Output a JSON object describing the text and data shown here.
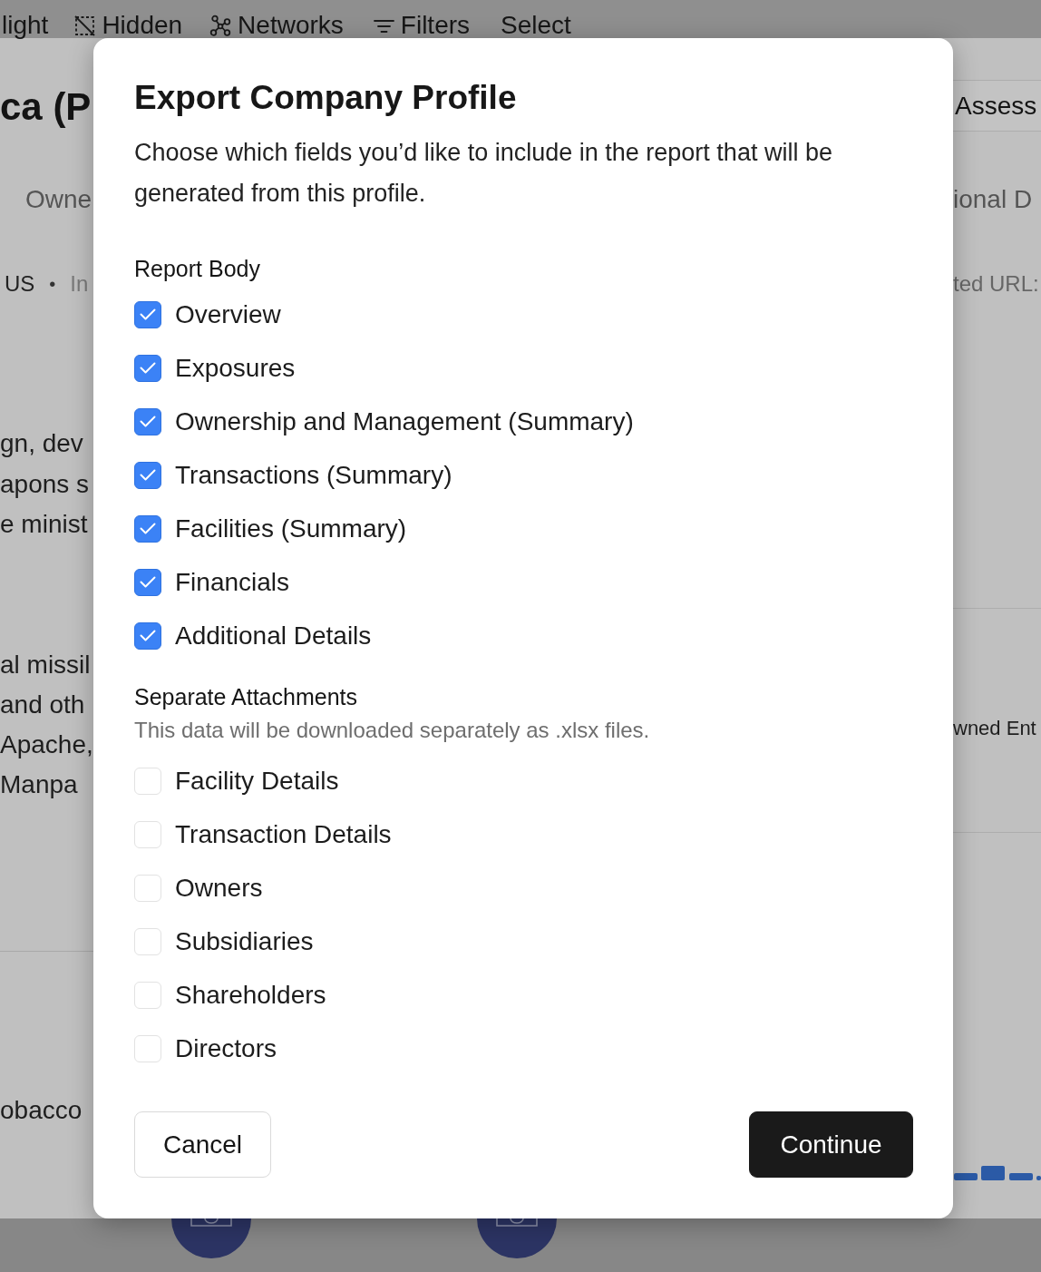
{
  "toolbar": [
    {
      "label": "light",
      "kind": "plain"
    },
    {
      "label": "Hidden",
      "kind": "hidden"
    },
    {
      "label": "Networks",
      "kind": "networks"
    },
    {
      "label": "Filters",
      "kind": "filters"
    },
    {
      "label": "Select",
      "kind": "plain"
    }
  ],
  "background_left": {
    "heading": "ca (P",
    "subheading": "Owne",
    "meta": {
      "country": "US",
      "separator": "•",
      "type": "In"
    },
    "paragraph_1": [
      "gn, dev",
      "apons s",
      "e minist"
    ],
    "paragraph_2": [
      "al missil",
      "and oth",
      "Apache,",
      "Manpa"
    ],
    "paragraph_3": "obacco"
  },
  "background_right": {
    "tab": "Assess",
    "subheading": "ional D",
    "label": "ted URL:",
    "item": "wned Ent"
  },
  "dialog": {
    "title": "Export Company Profile",
    "description": "Choose which fields you’d like to include in the report that will be generated from this profile.",
    "sections": [
      {
        "heading": "Report Body",
        "items": [
          {
            "label": "Overview",
            "checked": true
          },
          {
            "label": "Exposures",
            "checked": true
          },
          {
            "label": "Ownership and Management (Summary)",
            "checked": true
          },
          {
            "label": "Transactions (Summary)",
            "checked": true
          },
          {
            "label": "Facilities (Summary)",
            "checked": true
          },
          {
            "label": "Financials",
            "checked": true
          },
          {
            "label": "Additional Details",
            "checked": true
          }
        ]
      },
      {
        "heading": "Separate Attachments",
        "note": "This data will be downloaded separately as .xlsx files.",
        "items": [
          {
            "label": "Facility Details",
            "checked": false
          },
          {
            "label": "Transaction Details",
            "checked": false
          },
          {
            "label": "Owners",
            "checked": false
          },
          {
            "label": "Subsidiaries",
            "checked": false
          },
          {
            "label": "Shareholders",
            "checked": false
          },
          {
            "label": "Directors",
            "checked": false
          }
        ]
      }
    ],
    "buttons": [
      {
        "label": "Cancel",
        "kind": "secondary"
      },
      {
        "label": "Continue",
        "kind": "primary"
      }
    ]
  }
}
